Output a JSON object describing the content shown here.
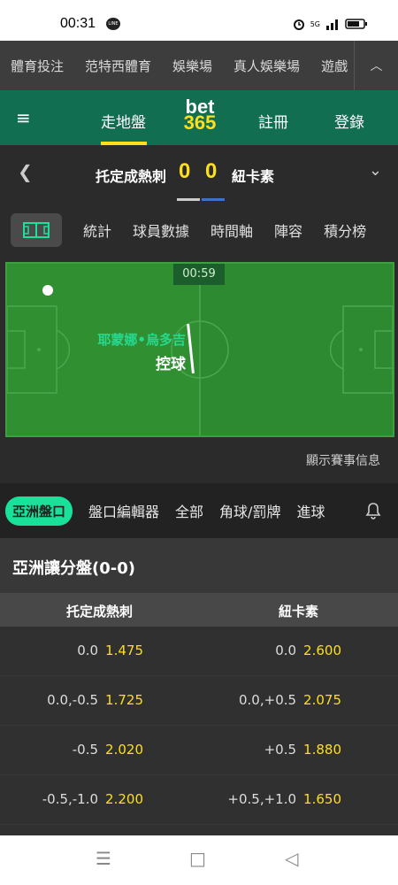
{
  "status": {
    "time": "00:31",
    "line": "LINE",
    "signal": "5G"
  },
  "sports_nav": {
    "items": [
      "體育投注",
      "范特西體育",
      "娛樂場",
      "真人娛樂場",
      "遊戲"
    ],
    "expand": "︿"
  },
  "header": {
    "live": "走地盤",
    "logo_top": "bet",
    "logo_bottom": "365",
    "register": "註冊",
    "login": "登錄",
    "menu": "≡"
  },
  "match": {
    "home": "托定成熱刺",
    "away": "紐卡素",
    "home_score": "0",
    "away_score": "0"
  },
  "tabs": [
    "統計",
    "球員數據",
    "時間軸",
    "陣容",
    "積分榜"
  ],
  "pitch": {
    "clock": "00:59",
    "team": "耶蒙娜•烏多吉",
    "action": "控球"
  },
  "show_info": "顯示賽事信息",
  "filters": {
    "active": "亞洲盤口",
    "items": [
      "盤口編輯器",
      "全部",
      "角球/罰牌",
      "進球"
    ]
  },
  "market": {
    "title": "亞洲讓分盤(0-0)",
    "home": "托定成熱刺",
    "away": "紐卡素",
    "rows": [
      {
        "h_line": "0.0",
        "h_odd": "1.475",
        "a_line": "0.0",
        "a_odd": "2.600"
      },
      {
        "h_line": "0.0,-0.5",
        "h_odd": "1.725",
        "a_line": "0.0,+0.5",
        "a_odd": "2.075"
      },
      {
        "h_line": "-0.5",
        "h_odd": "2.020",
        "a_line": "+0.5",
        "a_odd": "1.880"
      },
      {
        "h_line": "-0.5,-1.0",
        "h_odd": "2.200",
        "a_line": "+0.5,+1.0",
        "a_odd": "1.650"
      }
    ]
  },
  "navbar": {
    "recent": "☰",
    "home": "□",
    "back": "◁"
  },
  "colors": {
    "brand_green": "#126e51",
    "accent_yellow": "#ffdf1b",
    "pill": "#1ae199",
    "possession": "#27d98e"
  }
}
